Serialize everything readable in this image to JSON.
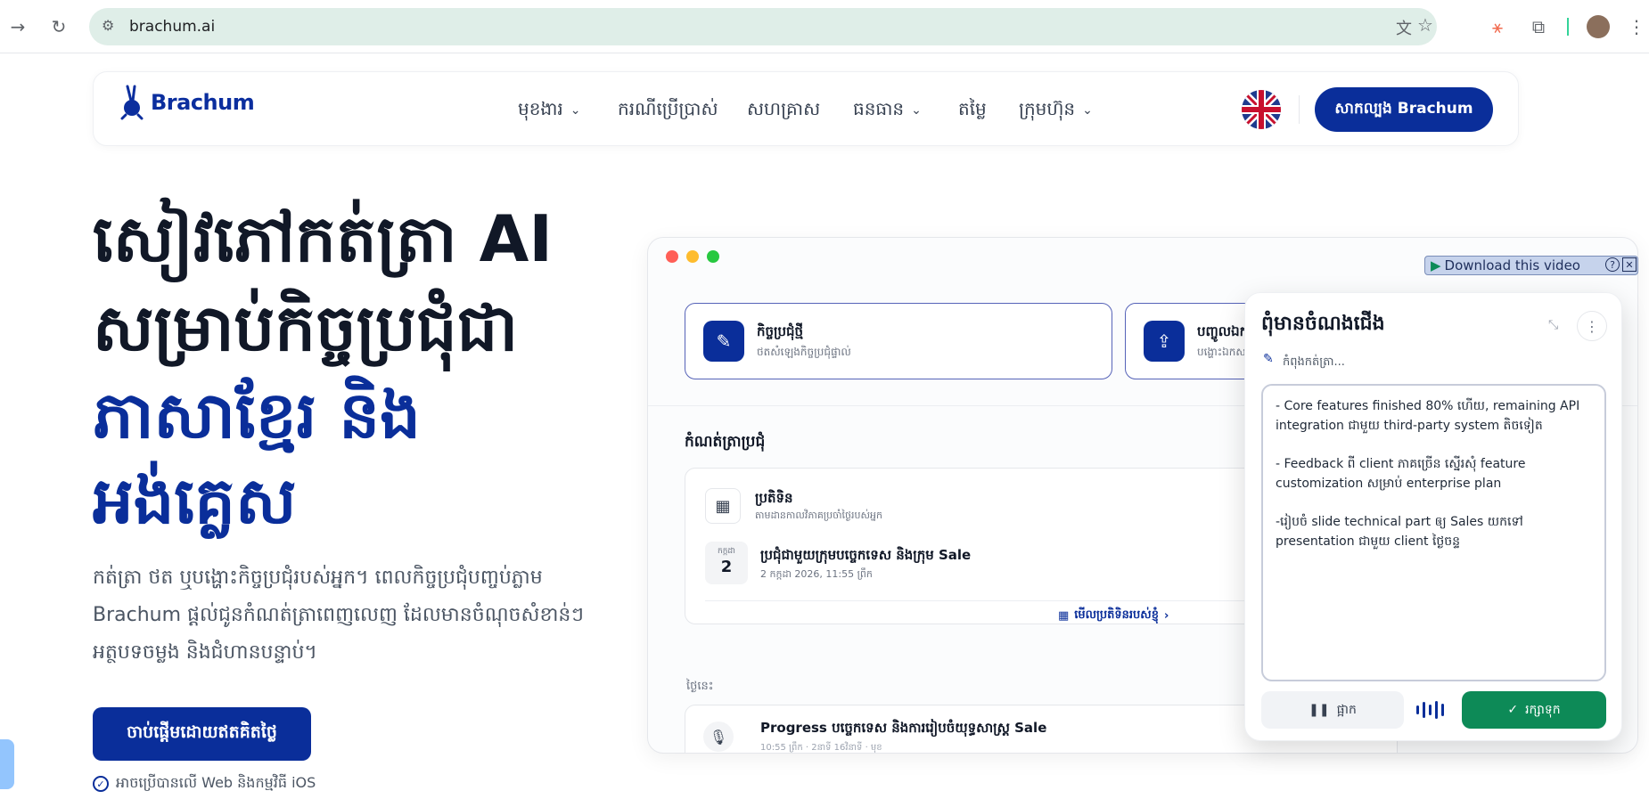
{
  "browser": {
    "url": "brachum.ai"
  },
  "nav": {
    "logo": "Brachum",
    "items": [
      "មុខងារ",
      "ករណីប្រើប្រាស់",
      "សហគ្រាស",
      "ធនធាន",
      "តម្លៃ",
      "ក្រុមហ៊ុន"
    ],
    "cta": "សាកល្បង Brachum"
  },
  "hero": {
    "line1": "សៀវភៅកត់ត្រា AI",
    "line2": "សម្រាប់កិច្ចប្រជុំជា",
    "line3": "ភាសាខ្មែរ និង",
    "line4": "អង់គ្លេស",
    "desc_l1": "កត់ត្រា ថត ឬបង្ហោះកិច្ចប្រជុំរបស់អ្នក។ ពេលកិច្ចប្រជុំបញ្ចប់ភ្លាម",
    "desc_l2": "Brachum ផ្ដល់ជូនកំណត់ត្រាពេញលេញ ដែលមានចំណុចសំខាន់ៗ",
    "desc_l3": "អត្ថបទចម្លង និងជំហានបន្ទាប់។",
    "cta": "ចាប់ផ្ដើមដោយឥតគិតថ្លៃ",
    "available": "អាចប្រើបានលើ Web និងកម្មវិធី iOS"
  },
  "app": {
    "card_new_title": "កិច្ចប្រជុំថ្មី",
    "card_new_sub": "ថតសំឡេងកិច្ចប្រជុំផ្ទាល់",
    "card_import_title": "បញ្ចូលឯក",
    "card_import_sub": "បង្ហោះឯកសារ",
    "section_notes": "កំណត់ត្រាប្រជុំ",
    "calendar_title": "ប្រតិទិន",
    "calendar_sub": "តាមដានកាលវិភាគប្រចាំថ្ងៃរបស់អ្នក",
    "event_month": "កក្កដា",
    "event_day": "2",
    "event_title": "ប្រជុំជាមួយក្រុមបច្ចេកទេស និងក្រុម Sale",
    "event_time": "2 កក្កដា 2026, 11:55 ព្រឹក",
    "view_calendar": "មើលប្រតិទិនរបស់ខ្ញុំ",
    "today": "ថ្ងៃនេះ",
    "rec_title": "Progress បច្ចេកទេស និងការរៀបចំយុទ្ធសាស្ត្រ Sale",
    "rec_meta": "10:55 ព្រឹក · 2នាទី 16វិនាទី · មុខ"
  },
  "download_bar": {
    "label": "Download this video"
  },
  "panel": {
    "title": "ពុំមានចំណងជើង",
    "status": "កំពុងកត់ត្រា...",
    "notes": [
      "- Core features finished 80% ហើយ, remaining API integration ជាមួយ third-party system តិចទៀត",
      "- Feedback ពី client ភាគច្រើន ស្នើរសុំ feature customization សម្រាប់ enterprise plan",
      "-រៀបចំ slide technical part ឲ្យ Sales យកទៅ presentation ជាមួយ client ថ្ងៃចន្ទ"
    ],
    "pause": "ផ្អាក",
    "save": "រក្សាទុក"
  }
}
